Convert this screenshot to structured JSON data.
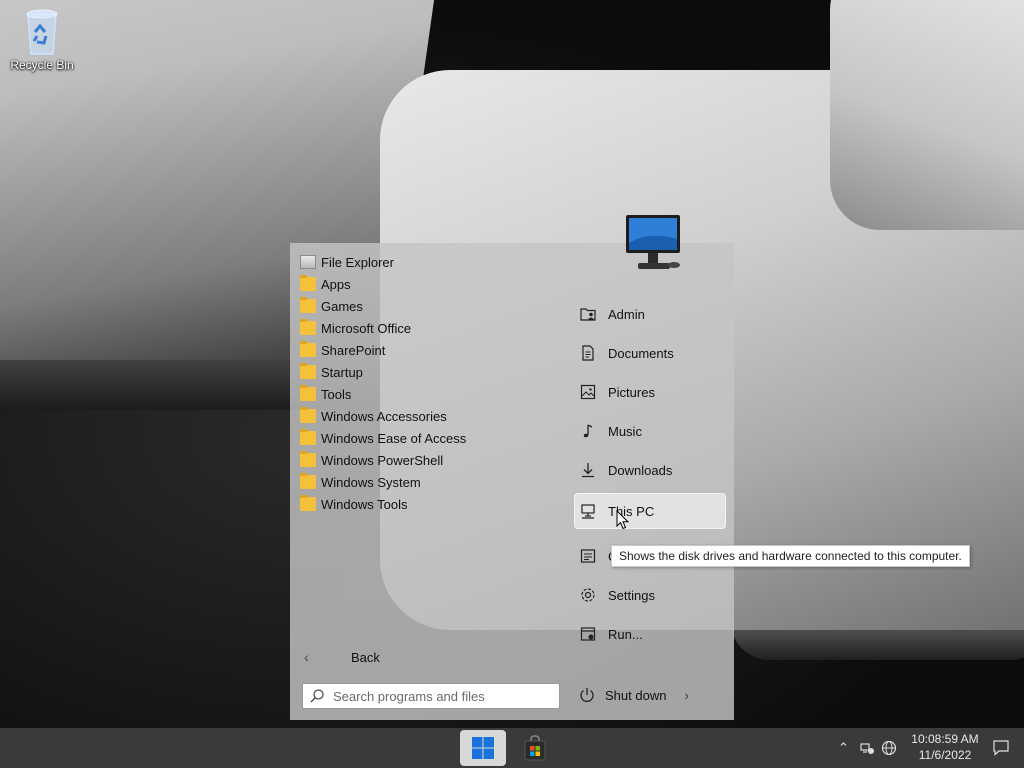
{
  "desktop": {
    "recycle_bin_label": "Recycle Bin"
  },
  "start_menu": {
    "programs": [
      {
        "label": "File Explorer",
        "icon": "file-explorer-icon"
      },
      {
        "label": "Apps",
        "icon": "folder-icon"
      },
      {
        "label": "Games",
        "icon": "folder-icon"
      },
      {
        "label": "Microsoft Office",
        "icon": "folder-icon"
      },
      {
        "label": "SharePoint",
        "icon": "folder-icon"
      },
      {
        "label": "Startup",
        "icon": "folder-icon"
      },
      {
        "label": "Tools",
        "icon": "folder-icon"
      },
      {
        "label": "Windows Accessories",
        "icon": "folder-icon"
      },
      {
        "label": "Windows Ease of Access",
        "icon": "folder-icon"
      },
      {
        "label": "Windows PowerShell",
        "icon": "folder-icon"
      },
      {
        "label": "Windows System",
        "icon": "folder-icon"
      },
      {
        "label": "Windows Tools",
        "icon": "folder-icon"
      }
    ],
    "places": [
      {
        "label": "Admin",
        "icon": "user-folder-icon"
      },
      {
        "label": "Documents",
        "icon": "document-icon"
      },
      {
        "label": "Pictures",
        "icon": "picture-icon"
      },
      {
        "label": "Music",
        "icon": "music-note-icon"
      },
      {
        "label": "Downloads",
        "icon": "download-icon"
      },
      {
        "label": "This PC",
        "icon": "computer-icon"
      },
      {
        "label": "C",
        "icon": "control-panel-icon"
      },
      {
        "label": "Settings",
        "icon": "gear-icon"
      },
      {
        "label": "Run...",
        "icon": "run-icon"
      }
    ],
    "back_label": "Back",
    "search_placeholder": "Search programs and files",
    "shutdown_label": "Shut down"
  },
  "tooltip": {
    "text": "Shows the disk drives and hardware connected to this computer."
  },
  "taskbar": {
    "time": "10:08:59 AM",
    "date": "11/6/2022"
  }
}
